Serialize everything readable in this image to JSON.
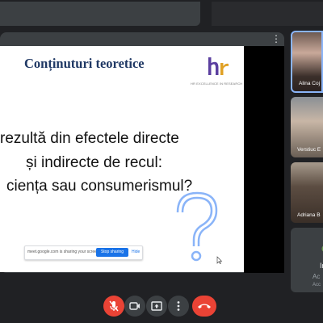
{
  "slide": {
    "title": "Conținuturi teoretice",
    "logo_caption": "HR EXCELLENCE IN RESEARCH",
    "question_lines": [
      "rezultă din efectele directe",
      "și indirecte de recul:",
      "ciența sau consumerismul?"
    ]
  },
  "share_bar": {
    "text": "meet.google.com is sharing your screen.",
    "stop_label": "Stop sharing",
    "hide_label": "Hide"
  },
  "participants": [
    {
      "name": "Alina Coj"
    },
    {
      "name": "Verstiuc E"
    },
    {
      "name": "Adriana B"
    },
    {
      "name": "Ir",
      "sub1": "Ac",
      "sub2": "Acc"
    }
  ],
  "colors": {
    "accent": "#8ab4f8",
    "danger": "#ea4335",
    "share_blue": "#1a73e8",
    "title_navy": "#1f3864"
  },
  "icons": {
    "mic": "mic-off-icon",
    "camera": "camera-icon",
    "present": "present-icon",
    "more": "more-vert-icon",
    "hangup": "hangup-icon"
  }
}
